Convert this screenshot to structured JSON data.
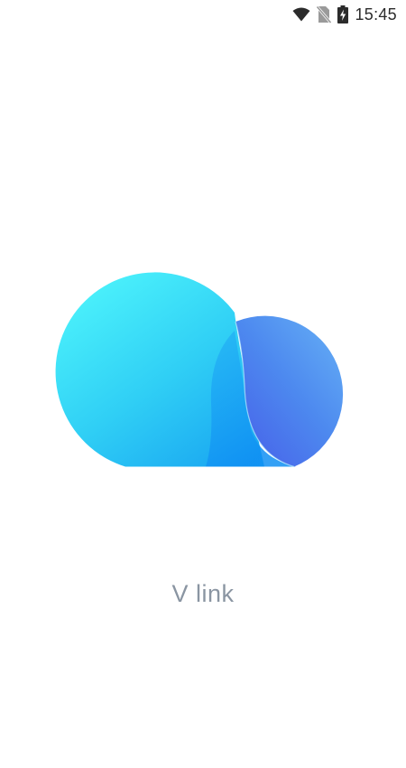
{
  "status_bar": {
    "time": "15:45",
    "icons": [
      "wifi-icon",
      "no-sim-icon",
      "battery-charging-icon"
    ]
  },
  "splash": {
    "app_name": "V link",
    "logo": "cloud-logo"
  },
  "colors": {
    "background": "#ffffff",
    "logo_cyan": "#4ef4fb",
    "logo_blue": "#1a9cf5",
    "logo_indigo": "#4a66ea",
    "app_name_text": "#8a95a2"
  }
}
